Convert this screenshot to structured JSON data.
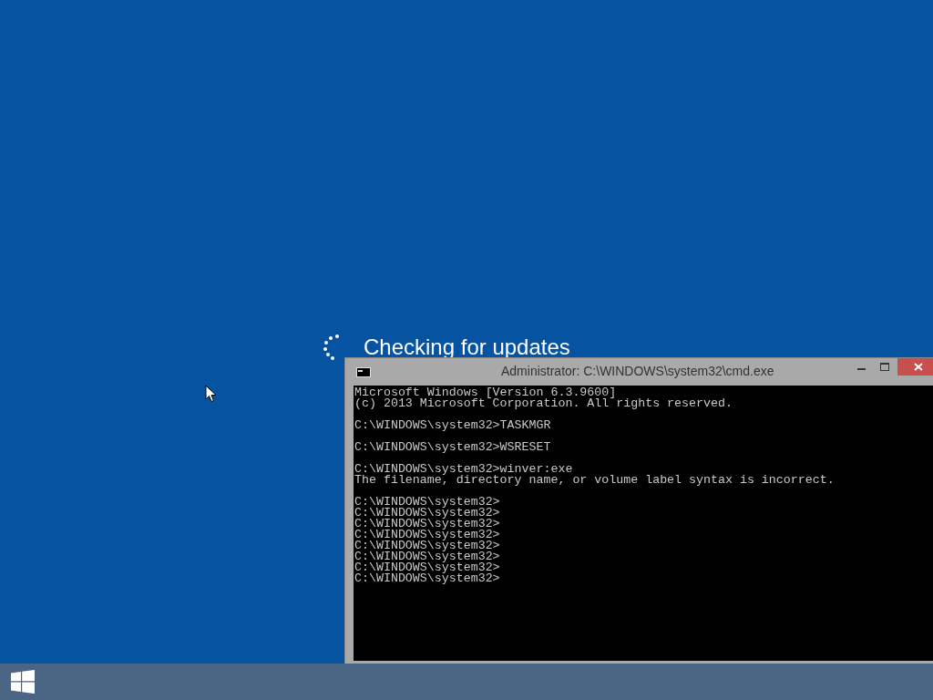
{
  "status": {
    "message": "Checking for updates"
  },
  "console_window": {
    "title": "Administrator: C:\\WINDOWS\\system32\\cmd.exe",
    "blocks": [
      [
        "Microsoft Windows [Version 6.3.9600]",
        "(c) 2013 Microsoft Corporation. All rights reserved."
      ],
      [
        "C:\\WINDOWS\\system32>TASKMGR"
      ],
      [
        "C:\\WINDOWS\\system32>WSRESET"
      ],
      [
        "C:\\WINDOWS\\system32>winver:exe",
        "The filename, directory name, or volume label syntax is incorrect."
      ],
      [
        "C:\\WINDOWS\\system32>",
        "C:\\WINDOWS\\system32>",
        "C:\\WINDOWS\\system32>",
        "C:\\WINDOWS\\system32>",
        "C:\\WINDOWS\\system32>",
        "C:\\WINDOWS\\system32>",
        "C:\\WINDOWS\\system32>",
        "C:\\WINDOWS\\system32>"
      ]
    ]
  }
}
